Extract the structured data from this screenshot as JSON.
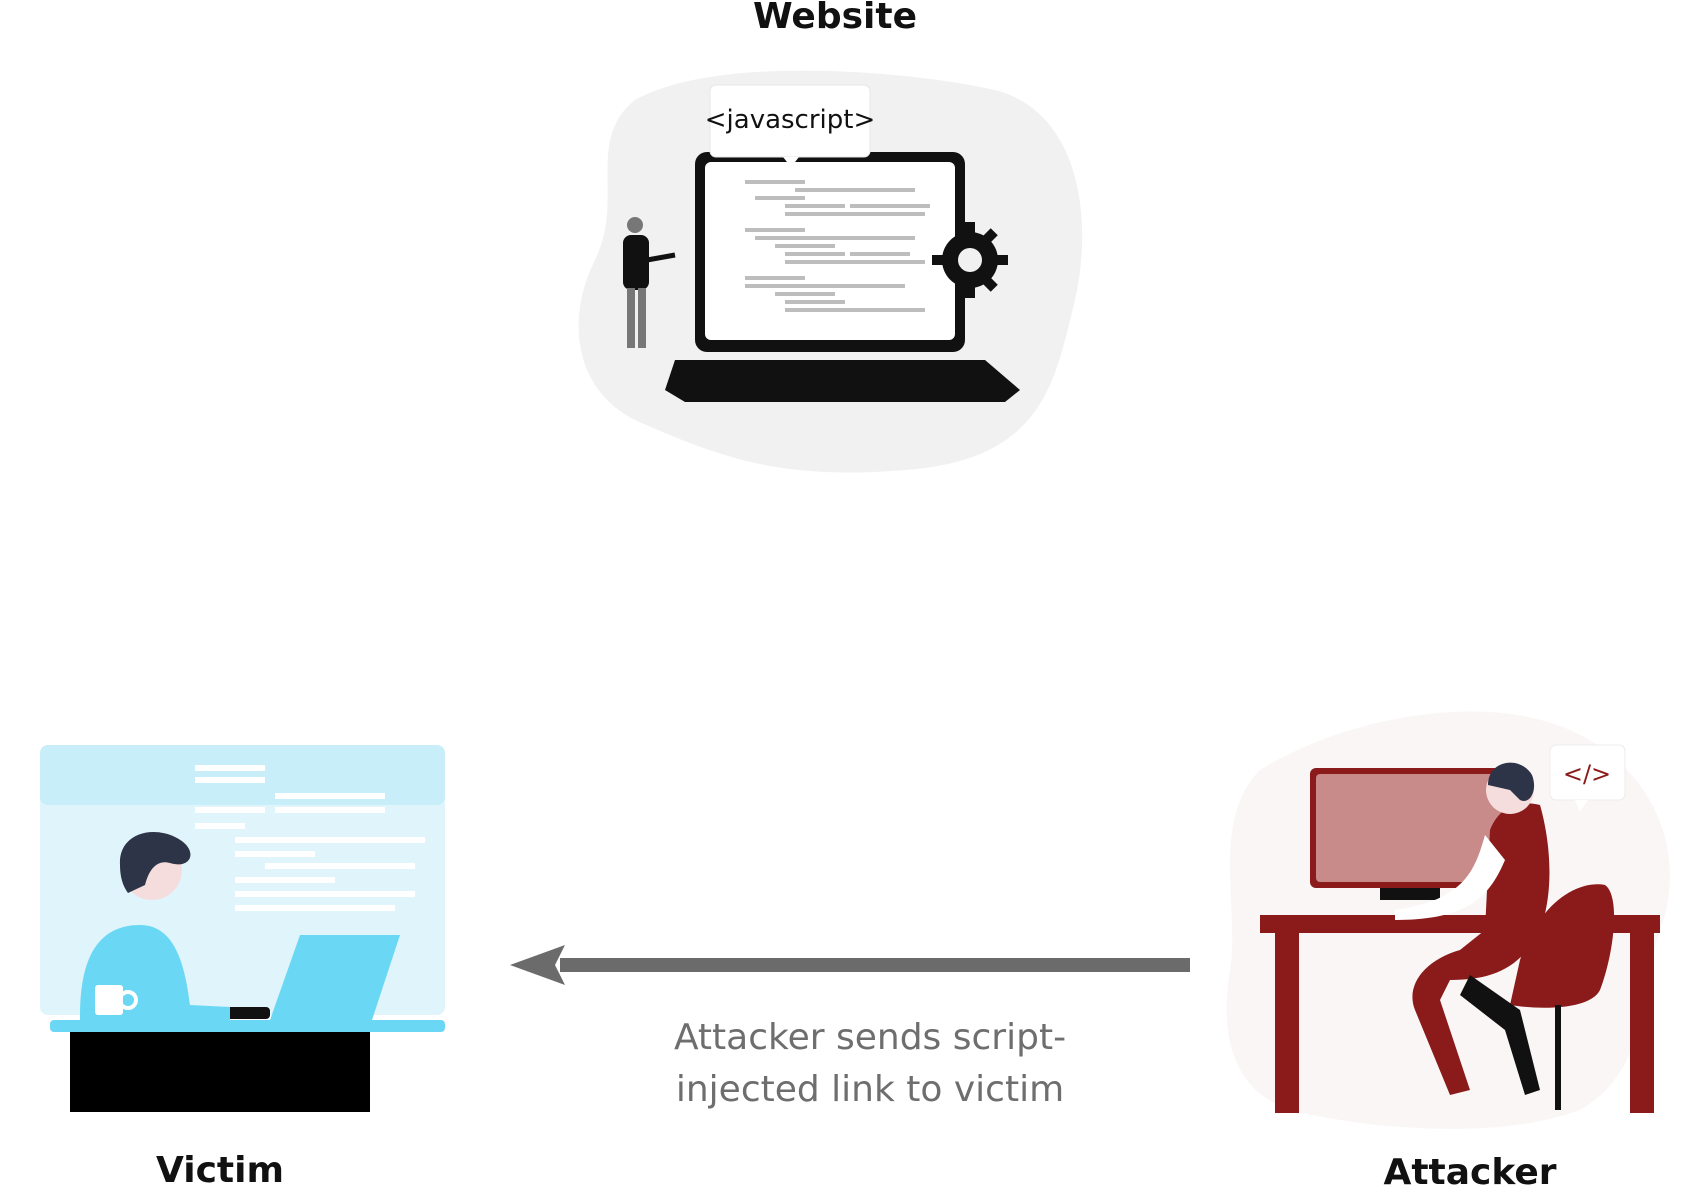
{
  "nodes": {
    "website": {
      "label": "Website",
      "bubble": "<javascript>"
    },
    "victim": {
      "label": "Victim"
    },
    "attacker": {
      "label": "Attacker",
      "bubble": "</>"
    }
  },
  "edge": {
    "caption_line1": "Attacker sends script-",
    "caption_line2": "injected link to victim"
  },
  "colors": {
    "attacker_accent": "#8b1a1a",
    "victim_accent": "#6ad8f4",
    "arrow": "#6b6b6b",
    "caption": "#6e6e6e"
  }
}
